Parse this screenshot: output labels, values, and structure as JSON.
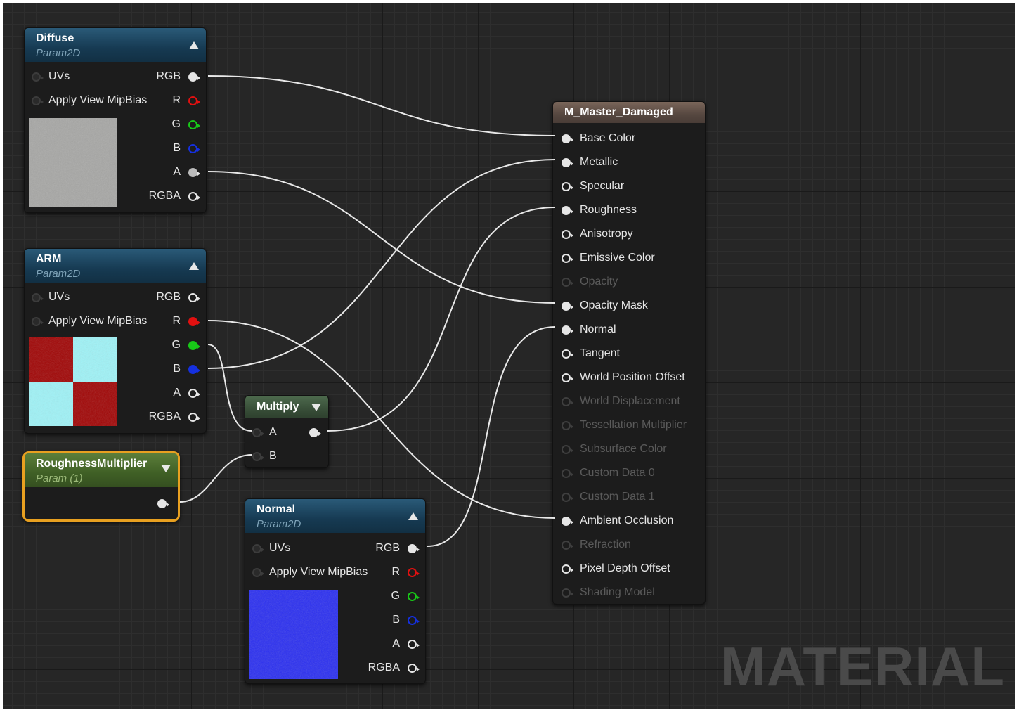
{
  "watermark": "MATERIAL",
  "colors": {
    "background": "#262626",
    "param_header": "#1d4a66",
    "multiply_header": "#3e5a3e",
    "scalar_header": "#4a6a2a",
    "selected_outline": "#e8a020",
    "result_header": "#5a4a40",
    "wire": "#e8e8e8"
  },
  "nodes": {
    "diffuse": {
      "title": "Diffuse",
      "subtitle": "Param2D",
      "inputs": [
        "UVs",
        "Apply View MipBias"
      ],
      "outputs": [
        "RGB",
        "R",
        "G",
        "B",
        "A",
        "RGBA"
      ],
      "preview": "grey-concrete-texture"
    },
    "arm": {
      "title": "ARM",
      "subtitle": "Param2D",
      "inputs": [
        "UVs",
        "Apply View MipBias"
      ],
      "outputs": [
        "RGB",
        "R",
        "G",
        "B",
        "A",
        "RGBA"
      ],
      "preview": "red-cyan-checker-texture"
    },
    "roughness_multiplier": {
      "title": "RoughnessMultiplier",
      "subtitle": "Param (1)"
    },
    "multiply": {
      "title": "Multiply",
      "inputs": [
        "A",
        "B"
      ]
    },
    "normal": {
      "title": "Normal",
      "subtitle": "Param2D",
      "inputs": [
        "UVs",
        "Apply View MipBias"
      ],
      "outputs": [
        "RGB",
        "R",
        "G",
        "B",
        "A",
        "RGBA"
      ],
      "preview": "blue-normal-map-texture"
    },
    "result": {
      "title": "M_Master_Damaged",
      "inputs": [
        {
          "label": "Base Color",
          "state": "connected"
        },
        {
          "label": "Metallic",
          "state": "connected"
        },
        {
          "label": "Specular",
          "state": "enabled"
        },
        {
          "label": "Roughness",
          "state": "connected"
        },
        {
          "label": "Anisotropy",
          "state": "enabled"
        },
        {
          "label": "Emissive Color",
          "state": "enabled"
        },
        {
          "label": "Opacity",
          "state": "disabled"
        },
        {
          "label": "Opacity Mask",
          "state": "connected"
        },
        {
          "label": "Normal",
          "state": "connected"
        },
        {
          "label": "Tangent",
          "state": "enabled"
        },
        {
          "label": "World Position Offset",
          "state": "enabled"
        },
        {
          "label": "World Displacement",
          "state": "disabled"
        },
        {
          "label": "Tessellation Multiplier",
          "state": "disabled"
        },
        {
          "label": "Subsurface Color",
          "state": "disabled"
        },
        {
          "label": "Custom Data 0",
          "state": "disabled"
        },
        {
          "label": "Custom Data 1",
          "state": "disabled"
        },
        {
          "label": "Ambient Occlusion",
          "state": "connected"
        },
        {
          "label": "Refraction",
          "state": "disabled"
        },
        {
          "label": "Pixel Depth Offset",
          "state": "enabled"
        },
        {
          "label": "Shading Model",
          "state": "disabled"
        }
      ]
    }
  }
}
